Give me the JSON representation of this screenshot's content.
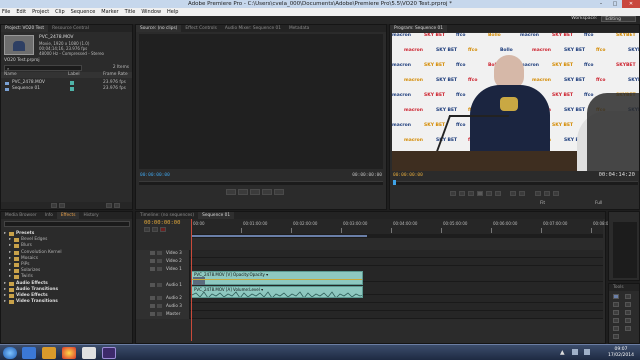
{
  "window": {
    "title": "Adobe Premiere Pro - C:\\Users\\cvela_000\\Documents\\Adobe\\Premiere Pro\\5.5\\VO20 Test.prproj *",
    "min": "–",
    "max": "□",
    "close": "✕"
  },
  "menu": [
    "File",
    "Edit",
    "Project",
    "Clip",
    "Sequence",
    "Marker",
    "Title",
    "Window",
    "Help"
  ],
  "workspace": {
    "label": "Workspace:",
    "value": "Editing"
  },
  "project": {
    "tabs": [
      "Project: VO20 Test",
      "Resource Central"
    ],
    "clip_name": "PVC_2478.MOV",
    "clip_info": [
      "Movie, 1920 x 1080 (1.0)",
      "00;04;14;16, 23.976 fps",
      "48000 Hz - Compressed - Stereo"
    ],
    "project_file": "VO20 Test.prproj",
    "items": "2 Items",
    "headers": [
      "Name",
      "Label",
      "Frame Rate"
    ],
    "rows": [
      {
        "name": "PVC_2478.MOV",
        "rate": "23.976 fps",
        "color": "#4fb3a8"
      },
      {
        "name": "Sequence 01",
        "rate": "23.976 fps",
        "color": "#4fb3a8"
      }
    ]
  },
  "source": {
    "tabs": [
      "Source: (no clips)",
      "Effect Controls",
      "Audio Mixer: Sequence 01",
      "Metadata"
    ],
    "tc_in": "00:00:00:00",
    "tc_out": "00:00:00:00"
  },
  "program": {
    "tab": "Program: Sequence 01",
    "tc_in": "00:00:00:00",
    "tc_out": "00:04:14:20",
    "fit": "Fit",
    "ratio": "Full"
  },
  "video_frame": {
    "sponsors": [
      "macron",
      "SKY BET",
      "ffco",
      "Bollo",
      "macron",
      "SKY BET",
      "ffco",
      "SKYBET"
    ]
  },
  "effects": {
    "tabs": [
      "Media Browser",
      "Info",
      "Effects",
      "History"
    ],
    "items": [
      {
        "label": "Presets",
        "level": 0,
        "folder": true
      },
      {
        "label": "Bevel Edges",
        "level": 1,
        "folder": true
      },
      {
        "label": "Blurs",
        "level": 1,
        "folder": true
      },
      {
        "label": "Convolution Kernel",
        "level": 1,
        "folder": true
      },
      {
        "label": "Mosaics",
        "level": 1,
        "folder": true
      },
      {
        "label": "PiPs",
        "level": 1,
        "folder": true
      },
      {
        "label": "Solarizes",
        "level": 1,
        "folder": true
      },
      {
        "label": "Twirls",
        "level": 1,
        "folder": true
      },
      {
        "label": "Audio Effects",
        "level": 0,
        "folder": true
      },
      {
        "label": "Audio Transitions",
        "level": 0,
        "folder": true
      },
      {
        "label": "Video Effects",
        "level": 0,
        "folder": true
      },
      {
        "label": "Video Transitions",
        "level": 0,
        "folder": true
      }
    ]
  },
  "timeline": {
    "tabs": [
      "Timeline: (no sequences)",
      "Sequence 01"
    ],
    "timecode": "00:00:00:00",
    "ruler": [
      "00:00",
      "00:01:00:00",
      "00:02:00:00",
      "00:03:00:00",
      "00:04:00:00",
      "00:05:00:00",
      "00:06:00:00",
      "00:07:00:00",
      "00:08:00:00"
    ],
    "tracks": [
      "Video 3",
      "Video 2",
      "Video 1",
      "Audio 1",
      "Audio 2",
      "Audio 3",
      "Master"
    ],
    "video_clip": "PVC_2478.MOV [V] Opacity:Opacity ▾",
    "audio_clip": "PVC_2478.MOV [A] Volume:Level ▾"
  },
  "tools_panel": {
    "tab": "Tools"
  },
  "taskbar": {
    "time": "09:07",
    "date": "17/02/2014"
  }
}
